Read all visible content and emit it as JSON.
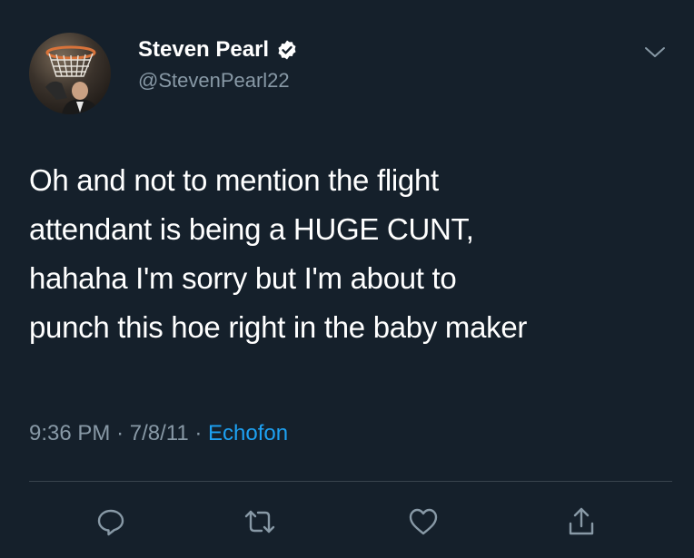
{
  "tweet": {
    "author": {
      "display_name": "Steven Pearl",
      "handle": "@StevenPearl22",
      "verified": true,
      "avatar_icon": "basketball-net-avatar"
    },
    "text": "Oh and not to mention the flight\nattendant is being a HUGE CUNT,\nhahaha I'm sorry but I'm about to\npunch this hoe right in the baby maker",
    "time": "9:36 PM",
    "date": "7/8/11",
    "source": "Echofon",
    "separator": "·"
  },
  "actions": {
    "reply_icon": "reply-icon",
    "retweet_icon": "retweet-icon",
    "like_icon": "heart-icon",
    "share_icon": "share-icon"
  },
  "colors": {
    "background": "#15202b",
    "text_primary": "#ffffff",
    "text_secondary": "#8899a6",
    "accent": "#1da1f2",
    "divider": "#38444d"
  }
}
